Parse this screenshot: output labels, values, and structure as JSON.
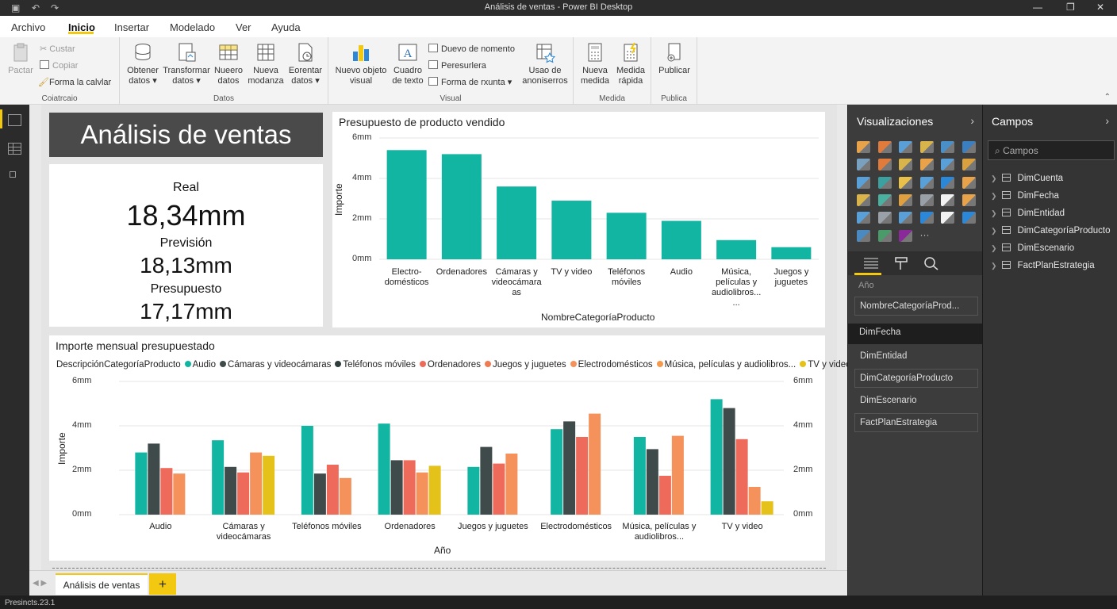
{
  "window": {
    "title": "Análisis de ventas - Power BI Desktop"
  },
  "menu": {
    "items": [
      "Archivo",
      "Inicio",
      "Insertar",
      "Modelado",
      "Ver",
      "Ayuda"
    ],
    "active": "Inicio"
  },
  "ribbon": {
    "clipboard": {
      "paste": "Pactar",
      "cut": "Custar",
      "copy": "Copiar",
      "format_painter": "Forma la calvlar",
      "label": "Coiatrcaio"
    },
    "data": {
      "label": "Datos",
      "buttons": [
        {
          "l1": "Obtener",
          "l2": "datos ▾",
          "icon": "database-icon"
        },
        {
          "l1": "Transformar",
          "l2": "datos ▾",
          "icon": "transform-icon"
        },
        {
          "l1": "Nueero",
          "l2": "datos",
          "icon": "table-icon"
        },
        {
          "l1": "Nueva",
          "l2": "modanza",
          "icon": "grid-icon"
        },
        {
          "l1": "Eorentar",
          "l2": "datos ▾",
          "icon": "refresh-doc-icon"
        }
      ]
    },
    "visual": {
      "label": "Visual",
      "new_visual": {
        "l1": "Nuevo objeto",
        "l2": "visual"
      },
      "textbox": {
        "l1": "Cuadro",
        "l2": "de texto"
      },
      "small": [
        "Duevo de nomento",
        "Peresurlera",
        "Forma de rxunta ▾"
      ],
      "usage": {
        "l1": "Usao de",
        "l2": "anoniserros"
      }
    },
    "measure": {
      "label": "Medida",
      "new_measure": {
        "l1": "Nueva",
        "l2": "medida"
      },
      "quick": {
        "l1": "Medida",
        "l2": "rápida"
      }
    },
    "publish": {
      "label": "Publica",
      "button": "Publicar"
    }
  },
  "report": {
    "title": "Análisis de ventas",
    "card": {
      "real_label": "Real",
      "real_value": "18,34mm",
      "forecast_label": "Previsión",
      "forecast_value": "18,13mm",
      "budget_label": "Presupuesto",
      "budget_value": "17,17mm"
    }
  },
  "chart_data": [
    {
      "type": "bar",
      "title": "Presupuesto de producto vendido",
      "xlabel": "NombreCategoríaProducto",
      "ylabel": "Importe",
      "ylim": [
        0,
        6
      ],
      "yticks": [
        "0mm",
        "2mm",
        "4mm",
        "6mm"
      ],
      "categories": [
        "Electro-\ndomésticos",
        "Ordenadores",
        "Cámaras y\nvideocámara\nas",
        "TV y video",
        "Teléfonos\nmóviles",
        "Audio",
        "Música,\npelículas y\naudiolibros...\n...",
        "Juegos y\njuguetes"
      ],
      "values": [
        5.4,
        5.2,
        3.6,
        2.9,
        2.3,
        1.9,
        0.95,
        0.6
      ],
      "color": "#12b5a2"
    },
    {
      "type": "bar",
      "title": "Importe mensual presupuestado",
      "legend_title": "DescripciónCategoríaProducto",
      "xlabel": "Año",
      "ylabel": "Importe",
      "ylim": [
        0,
        6
      ],
      "yticks": [
        "0mm",
        "2mm",
        "4mm",
        "6mm"
      ],
      "categories": [
        "Audio",
        "Cámaras y\nvideocámaras",
        "Teléfonos móviles",
        "Ordenadores",
        "Juegos y juguetes",
        "Electrodomésticos",
        "Música, películas y\naudiolibros...",
        "TV y video"
      ],
      "series": [
        {
          "name": "Audio",
          "color": "#12b5a2",
          "values": [
            2.8,
            3.35,
            4.0,
            4.1,
            2.15,
            3.85,
            3.5,
            5.2
          ]
        },
        {
          "name": "Cámaras y videocámaras",
          "color": "#3f4a4a",
          "values": [
            3.2,
            2.15,
            1.85,
            2.45,
            3.05,
            4.2,
            2.95,
            4.8
          ]
        },
        {
          "name": "Teléfonos móviles",
          "color": "#2f3c3c",
          "values": [
            null,
            null,
            null,
            null,
            null,
            null,
            null,
            null
          ]
        },
        {
          "name": "Ordenadores",
          "color": "#ee6a5a",
          "values": [
            2.1,
            1.9,
            2.25,
            2.45,
            2.3,
            3.5,
            1.75,
            3.4
          ]
        },
        {
          "name": "Juegos y juguetes",
          "color": "#f07b52",
          "values": [
            null,
            null,
            null,
            null,
            null,
            null,
            null,
            null
          ]
        },
        {
          "name": "Electrodomésticos",
          "color": "#f5915a",
          "values": [
            1.85,
            2.8,
            1.65,
            1.9,
            2.75,
            4.55,
            3.55,
            1.25
          ]
        },
        {
          "name": "Música, películas y audiolibros...",
          "color": "#f39a4e",
          "values": [
            null,
            null,
            null,
            null,
            null,
            null,
            null,
            null
          ]
        },
        {
          "name": "TV y video",
          "color": "#e4c21a",
          "values": [
            null,
            2.65,
            null,
            2.2,
            null,
            null,
            null,
            0.6
          ]
        }
      ]
    }
  ],
  "tabs": {
    "pages": [
      "Análisis de ventas"
    ],
    "add": "+"
  },
  "status": "Presincts.23.1",
  "viz_pane": {
    "title": "Visualizaciones",
    "wells_label": "Año",
    "wells": [
      "NombreCategoríaProd...",
      "DimFecha",
      "DimEntidad",
      "DimCategoríaProducto",
      "DimEscenario",
      "FactPlanEstrategia"
    ],
    "more": "···"
  },
  "fields_pane": {
    "title": "Campos",
    "search_placeholder": "Campos",
    "tables": [
      "DimCuenta",
      "DimFecha",
      "DimEntidad",
      "DimCategoríaProducto",
      "DimEscenario",
      "FactPlanEstrategia"
    ]
  }
}
